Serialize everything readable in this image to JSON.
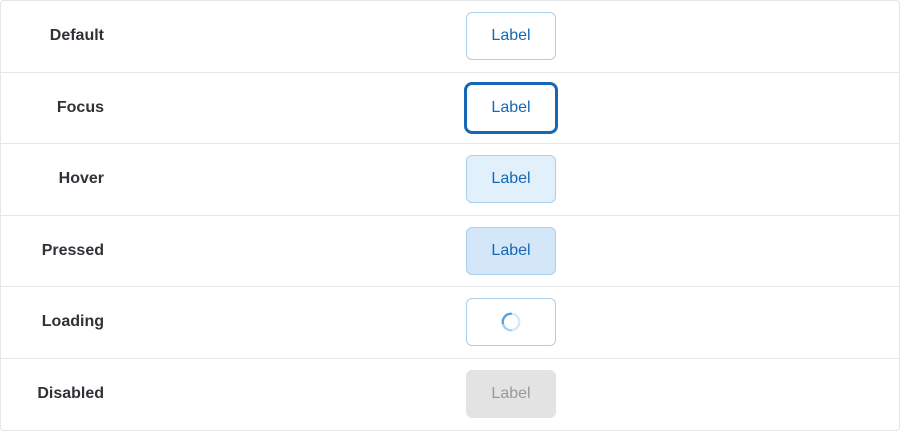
{
  "colors": {
    "label_text": "#2f3237",
    "button_text": "#1568b5",
    "button_border": "#a8d0ee",
    "hover_bg": "#e2f0fb",
    "pressed_bg": "#d4e7f8",
    "disabled_bg": "#e3e3e3",
    "disabled_text": "#9a9a9a",
    "divider": "#e3e6ea"
  },
  "rows": [
    {
      "state": "Default",
      "button_label": "Label"
    },
    {
      "state": "Focus",
      "button_label": "Label"
    },
    {
      "state": "Hover",
      "button_label": "Label"
    },
    {
      "state": "Pressed",
      "button_label": "Label"
    },
    {
      "state": "Loading",
      "button_icon": "loading-spinner-icon"
    },
    {
      "state": "Disabled",
      "button_label": "Label"
    }
  ]
}
